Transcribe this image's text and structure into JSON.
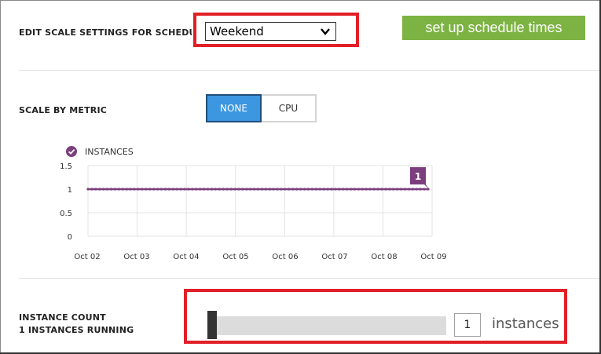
{
  "schedule": {
    "label": "EDIT SCALE SETTINGS FOR SCHEDULE",
    "selected": "Weekend",
    "setup_button": "set up schedule times"
  },
  "scale_by_metric": {
    "label": "SCALE BY METRIC",
    "options": [
      "NONE",
      "CPU"
    ],
    "selected": "NONE"
  },
  "chart_data": {
    "type": "line",
    "series": [
      {
        "name": "INSTANCES",
        "color": "#7b3f7e",
        "values": [
          1,
          1,
          1,
          1,
          1,
          1,
          1,
          1
        ]
      }
    ],
    "x": [
      "Oct 02",
      "Oct 03",
      "Oct 04",
      "Oct 05",
      "Oct 06",
      "Oct 07",
      "Oct 08",
      "Oct 09"
    ],
    "yticks": [
      "1.5",
      "1",
      "0.5",
      "0"
    ],
    "ylim": [
      0,
      1.5
    ],
    "grid": true,
    "end_label": "1",
    "legend": "top-left"
  },
  "instance_count": {
    "title": "INSTANCE COUNT",
    "subtitle": "1 INSTANCES RUNNING",
    "value": "1",
    "unit": "instances",
    "slider_fraction": 0.0
  },
  "colors": {
    "accent": "#3d96e0",
    "highlight": "#e21f27",
    "setup_button": "#7cb342",
    "series": "#7b3f7e"
  }
}
